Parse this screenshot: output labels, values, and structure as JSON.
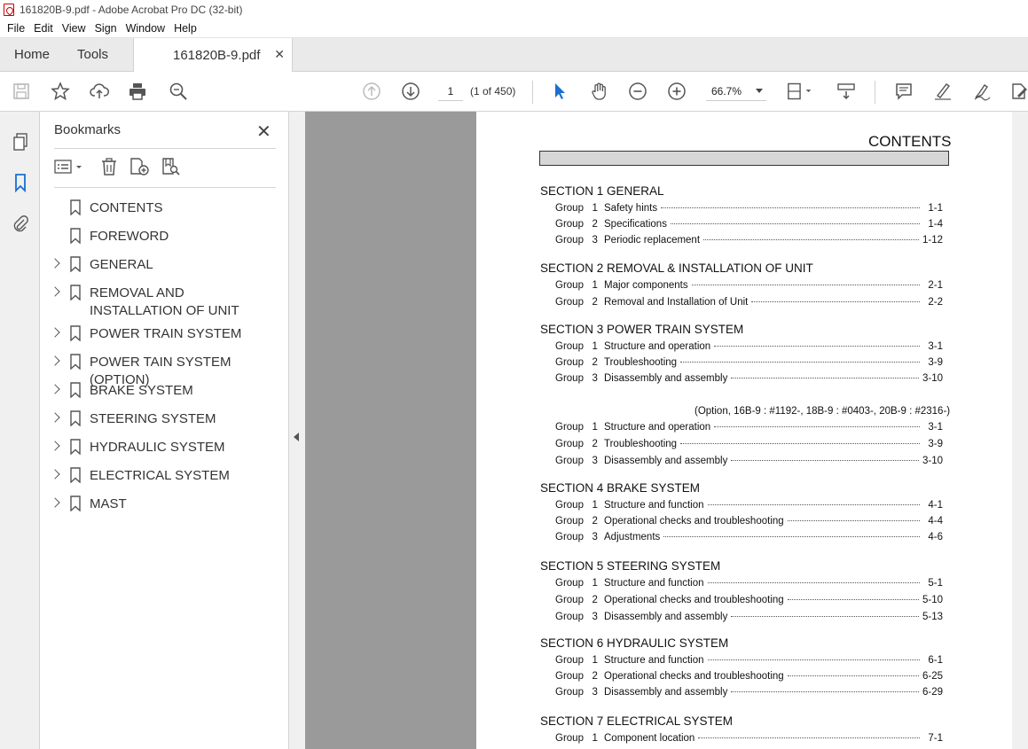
{
  "window": {
    "title": "161820B-9.pdf - Adobe Acrobat Pro DC (32-bit)"
  },
  "menu": [
    "File",
    "Edit",
    "View",
    "Sign",
    "Window",
    "Help"
  ],
  "tabs": {
    "home": "Home",
    "tools": "Tools",
    "doc": "161820B-9.pdf"
  },
  "toolbar": {
    "page_value": "1",
    "page_count": "(1 of 450)",
    "zoom": "66.7%"
  },
  "bookmarks_panel": {
    "title": "Bookmarks",
    "items": [
      {
        "label": "CONTENTS",
        "expandable": false
      },
      {
        "label": "FOREWORD",
        "expandable": false
      },
      {
        "label": "GENERAL",
        "expandable": true
      },
      {
        "label": "REMOVAL AND INSTALLATION OF UNIT",
        "expandable": true
      },
      {
        "label": "POWER TRAIN SYSTEM",
        "expandable": true
      },
      {
        "label": "POWER TAIN SYSTEM (OPTION)",
        "expandable": true
      },
      {
        "label": "BRAKE SYSTEM",
        "expandable": true
      },
      {
        "label": "STEERING SYSTEM",
        "expandable": true
      },
      {
        "label": "HYDRAULIC SYSTEM",
        "expandable": true
      },
      {
        "label": "ELECTRICAL SYSTEM",
        "expandable": true
      },
      {
        "label": "MAST",
        "expandable": true
      }
    ]
  },
  "document": {
    "heading": "CONTENTS",
    "sections": [
      {
        "title": "SECTION 1  GENERAL",
        "groups": [
          {
            "g": "Group   1",
            "t": "Safety hints",
            "p": "1-1"
          },
          {
            "g": "Group   2",
            "t": "Specifications",
            "p": "1-4"
          },
          {
            "g": "Group   3",
            "t": "Periodic replacement",
            "p": "1-12"
          }
        ]
      },
      {
        "title": "SECTION 2  REMOVAL & INSTALLATION OF UNIT",
        "groups": [
          {
            "g": "Group   1",
            "t": "Major components",
            "p": "2-1"
          },
          {
            "g": "Group   2",
            "t": "Removal and Installation of Unit",
            "p": "2-2"
          }
        ]
      },
      {
        "title": "SECTION 3  POWER TRAIN SYSTEM",
        "groups": [
          {
            "g": "Group   1",
            "t": "Structure and operation",
            "p": "3-1"
          },
          {
            "g": "Group   2",
            "t": "Troubleshooting",
            "p": "3-9"
          },
          {
            "g": "Group   3",
            "t": "Disassembly and assembly",
            "p": "3-10"
          }
        ]
      },
      {
        "title": "",
        "option": "(Option, 16B-9 : #1192-, 18B-9 : #0403-, 20B-9 : #2316-)",
        "groups": [
          {
            "g": "Group   1",
            "t": "Structure and operation",
            "p": "3-1"
          },
          {
            "g": "Group   2",
            "t": "Troubleshooting",
            "p": "3-9"
          },
          {
            "g": "Group   3",
            "t": "Disassembly and assembly",
            "p": "3-10"
          }
        ]
      },
      {
        "title": "SECTION 4  BRAKE SYSTEM",
        "groups": [
          {
            "g": "Group   1",
            "t": "Structure and function",
            "p": "4-1"
          },
          {
            "g": "Group   2",
            "t": "Operational checks and troubleshooting",
            "p": "4-4"
          },
          {
            "g": "Group   3",
            "t": "Adjustments",
            "p": "4-6"
          }
        ]
      },
      {
        "title": "SECTION 5  STEERING SYSTEM",
        "groups": [
          {
            "g": "Group   1",
            "t": "Structure and function",
            "p": "5-1"
          },
          {
            "g": "Group   2",
            "t": "Operational checks and troubleshooting",
            "p": "5-10"
          },
          {
            "g": "Group   3",
            "t": "Disassembly and assembly",
            "p": "5-13"
          }
        ]
      },
      {
        "title": "SECTION 6  HYDRAULIC SYSTEM",
        "groups": [
          {
            "g": "Group   1",
            "t": "Structure and function",
            "p": "6-1"
          },
          {
            "g": "Group   2",
            "t": "Operational checks and troubleshooting",
            "p": "6-25"
          },
          {
            "g": "Group   3",
            "t": "Disassembly and assembly",
            "p": "6-29"
          }
        ]
      },
      {
        "title": "SECTION 7  ELECTRICAL SYSTEM",
        "groups": [
          {
            "g": "Group   1",
            "t": "Component location",
            "p": "7-1"
          }
        ]
      }
    ]
  }
}
